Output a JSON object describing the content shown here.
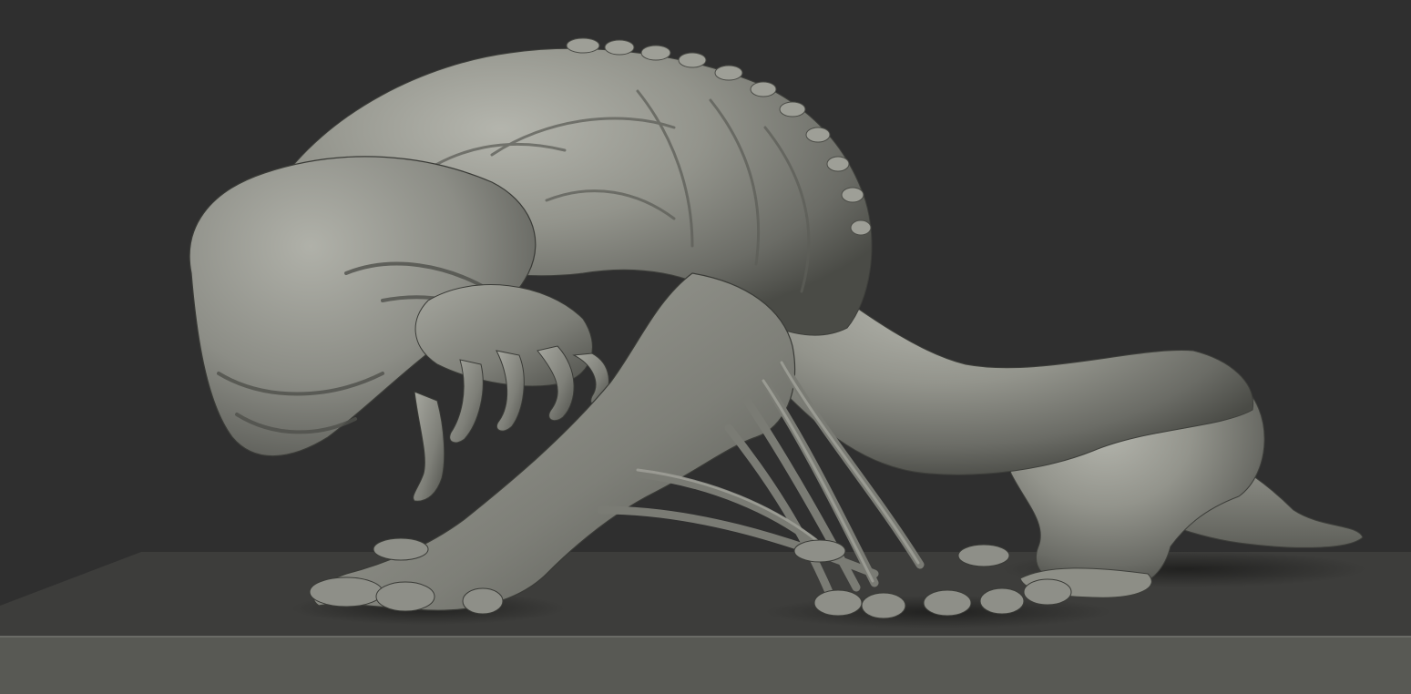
{
  "scene": {
    "subject": "creature-sculpt",
    "colors": {
      "background": "#2f2f2f",
      "floor_top": "#3d3d3b",
      "floor_front": "#585954",
      "clay_light": "#a9aaa2",
      "clay_mid": "#85867f",
      "clay_dark": "#4a4b46",
      "shadow": "#1f1f1e"
    }
  }
}
